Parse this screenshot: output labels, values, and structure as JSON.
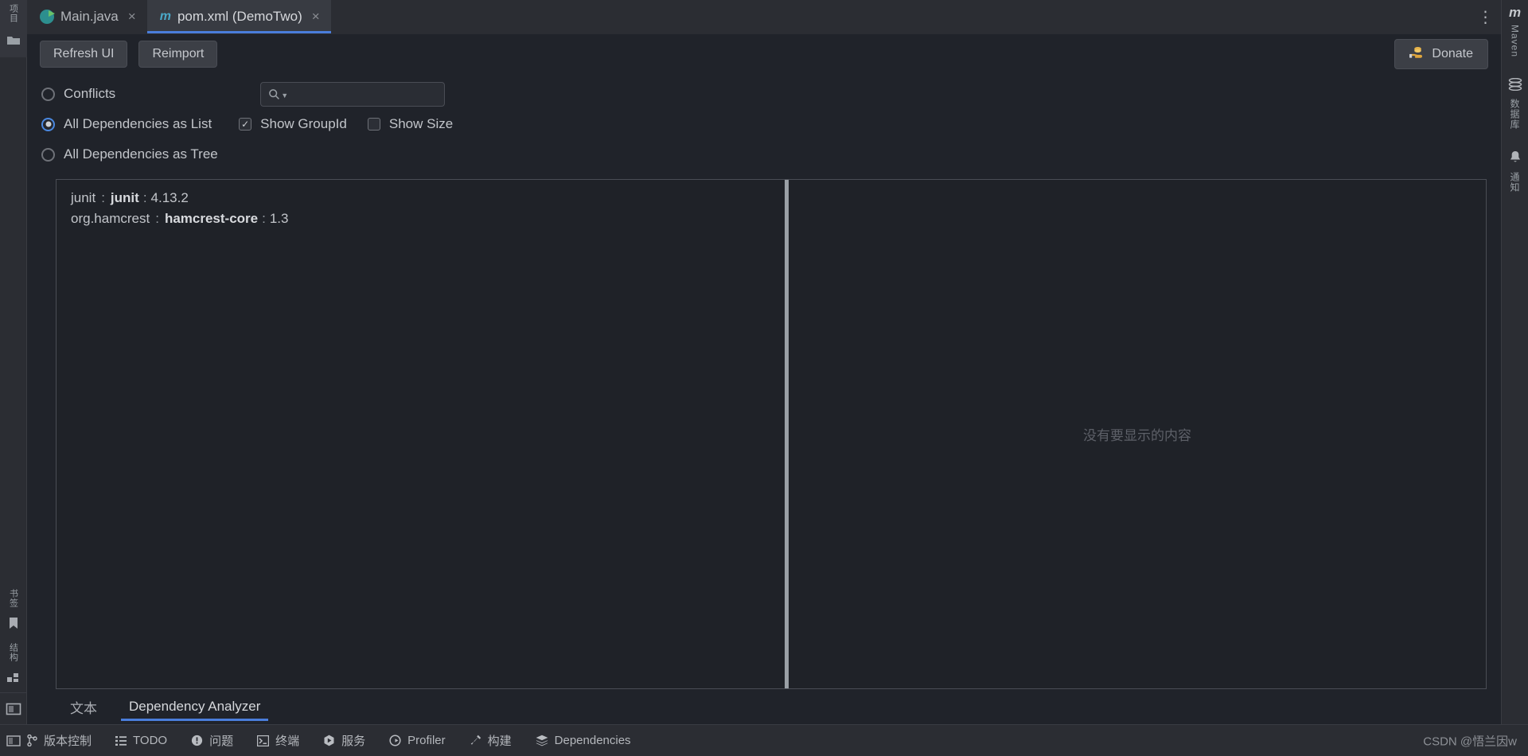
{
  "window": {
    "theme_accent": "#4a7ddb",
    "background": "#20232a"
  },
  "editor_tabs": [
    {
      "label": "Main.java",
      "icon": "java-class-icon",
      "close": "×",
      "active": false
    },
    {
      "label": "pom.xml (DemoTwo)",
      "icon": "maven-icon",
      "icon_glyph": "m",
      "close": "×",
      "active": true
    }
  ],
  "tabbar": {
    "more_label": "⋮",
    "more_name": "editor-tabs-more-button"
  },
  "toolbar": {
    "refresh_label": "Refresh UI",
    "reimport_label": "Reimport",
    "donate_label": "Donate",
    "donate_icon": "coins-hand-icon",
    "donate_glyph": "🪙"
  },
  "options": {
    "conflicts": {
      "label": "Conflicts",
      "checked": false
    },
    "as_list": {
      "label": "All Dependencies as List",
      "checked": true
    },
    "as_tree": {
      "label": "All Dependencies as Tree",
      "checked": false
    },
    "show_groupid": {
      "label": "Show GroupId",
      "checked": true,
      "mark": "✓"
    },
    "show_size": {
      "label": "Show Size",
      "checked": false,
      "mark": ""
    }
  },
  "search": {
    "value": "",
    "placeholder": "",
    "icon": "search-icon"
  },
  "dependencies": {
    "items": [
      {
        "group": "junit",
        "sep": ":",
        "artifact": "junit",
        "sep2": ":",
        "version": "4.13.2"
      },
      {
        "group": "org.hamcrest",
        "sep": ":",
        "artifact": "hamcrest-core",
        "sep2": ":",
        "version": "1.3"
      }
    ]
  },
  "detail_pane": {
    "empty_message": "没有要显示的内容"
  },
  "bottom_tabs": [
    {
      "label": "文本",
      "active": false
    },
    {
      "label": "Dependency Analyzer",
      "active": true
    }
  ],
  "statusbar": {
    "items": [
      {
        "label": "版本控制",
        "icon": "branch-icon",
        "glyph": "⑂"
      },
      {
        "label": "TODO",
        "icon": "list-icon",
        "glyph": "☰"
      },
      {
        "label": "问题",
        "icon": "warning-circle-icon",
        "glyph": "ⓘ"
      },
      {
        "label": "终端",
        "icon": "terminal-icon",
        "glyph": "▶_"
      },
      {
        "label": "服务",
        "icon": "services-icon",
        "glyph": "▶"
      },
      {
        "label": "Profiler",
        "icon": "profiler-icon",
        "glyph": "◔"
      },
      {
        "label": "构建",
        "icon": "hammer-icon",
        "glyph": "⚒"
      },
      {
        "label": "Dependencies",
        "icon": "layers-icon",
        "glyph": "≣"
      }
    ],
    "watermark": "CSDN @悟兰因w"
  },
  "left_strip": {
    "top": [
      {
        "label": "项目",
        "icon": "project-icon"
      },
      {
        "label": "",
        "icon": "folder-icon",
        "glyph": "▰"
      }
    ],
    "bottom": [
      {
        "label": "书签",
        "icon": "bookmark-icon",
        "glyph": "⚑"
      },
      {
        "label": "结构",
        "icon": "structure-icon",
        "glyph": "▣"
      }
    ],
    "footer": {
      "label": "",
      "icon": "layout-icon",
      "glyph": "▢"
    }
  },
  "right_strip": {
    "items": [
      {
        "label": "Maven",
        "icon": "maven-icon",
        "glyph": "m"
      },
      {
        "label": "数据库",
        "icon": "database-icon",
        "glyph": "◓"
      },
      {
        "label": "通知",
        "icon": "bell-icon",
        "glyph": "🔔"
      }
    ]
  }
}
